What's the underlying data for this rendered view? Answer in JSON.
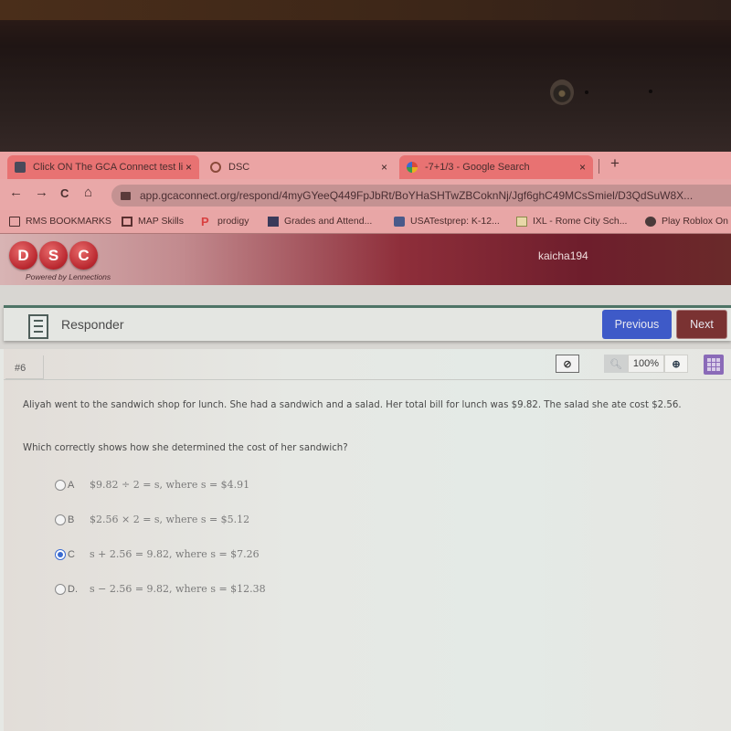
{
  "browser": {
    "tabs": [
      {
        "title": "Click ON The GCA Connect test li",
        "icon": "classroom-icon",
        "active": true
      },
      {
        "title": "DSC",
        "icon": "dsc-favicon",
        "active": false
      },
      {
        "title": "-7+1/3 - Google Search",
        "icon": "google-icon",
        "active": true
      }
    ],
    "close_glyph": "×",
    "new_tab_glyph": "+",
    "nav": {
      "back": "←",
      "forward": "→",
      "reload": "C",
      "home": "⌂"
    },
    "url": "app.gcaconnect.org/respond/4myGYeeQ449FpJbRt/BoYHaSHTwZBCoknNj/Jgf6ghC49MCsSmiel/D3QdSuW8X..."
  },
  "bookmarks": [
    {
      "label": "RMS BOOKMARKS",
      "icon": "folder-icon"
    },
    {
      "label": "MAP Skills",
      "icon": "map-icon"
    },
    {
      "label": "prodigy",
      "icon": "prodigy-icon"
    },
    {
      "label": "Grades and Attend...",
      "icon": "grades-icon"
    },
    {
      "label": "USATestprep: K-12...",
      "icon": "usatestprep-icon"
    },
    {
      "label": "IXL - Rome City Sch...",
      "icon": "ixl-icon"
    },
    {
      "label": "Play Roblox On",
      "icon": "roblox-icon"
    }
  ],
  "app": {
    "logo_letters": [
      "D",
      "S",
      "C"
    ],
    "powered_by": "Powered by Lennections",
    "username": "kaicha194",
    "responder_title": "Responder",
    "previous_label": "Previous",
    "next_label": "Next"
  },
  "question": {
    "number": "#6",
    "eliminate_glyph": "⊘",
    "zoom_out_glyph": "🔍︎",
    "zoom_level": "100%",
    "zoom_in_glyph": "⊕",
    "stem": "Aliyah went to the sandwich shop for lunch.  She had a sandwich and a salad. Her total bill for lunch was $9.82.  The salad she ate cost $2.56.",
    "prompt": "Which correctly shows how she determined the cost of her sandwich?",
    "selected": "C",
    "choices": [
      {
        "letter": "A",
        "text": "$9.82 ÷ 2 = s, where s = $4.91"
      },
      {
        "letter": "B",
        "text": "$2.56 × 2 = s, where s = $5.12"
      },
      {
        "letter": "C",
        "text": "s + 2.56 = 9.82, where s = $7.26"
      },
      {
        "letter": "D.",
        "text": "s − 2.56 = 9.82, where s = $12.38"
      }
    ]
  },
  "colors": {
    "previous_button": "#3e5ac8",
    "next_button": "#7a3232",
    "selected_radio": "#3a6ad0",
    "header_accent": "#8e2e3a"
  }
}
